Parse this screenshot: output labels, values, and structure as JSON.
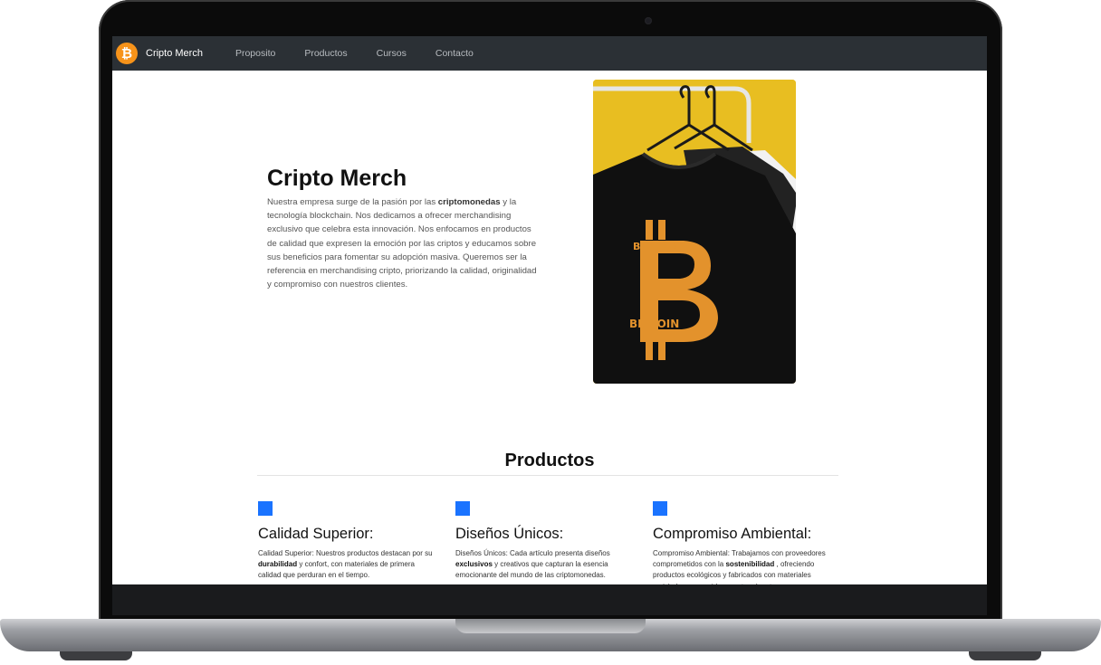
{
  "navbar": {
    "logo_symbol": "₿",
    "brand": "Cripto Merch",
    "links": [
      "Proposito",
      "Productos",
      "Cursos",
      "Contacto"
    ]
  },
  "hero": {
    "title": "Cripto Merch",
    "text_before": "Nuestra empresa surge de la pasión por las ",
    "text_bold": "criptomonedas",
    "text_after": " y la tecnología blockchain. Nos dedicamos a ofrecer merchandising exclusivo que celebra esta innovación. Nos enfocamos en productos de calidad que expresen la emoción por las criptos y educamos sobre sus beneficios para fomentar su adopción masiva. Queremos ser la referencia en merchandising cripto, priorizando la calidad, originalidad y compromiso con nuestros clientes.",
    "image_word": "BITCOIN"
  },
  "products": {
    "title": "Productos",
    "items": [
      {
        "title": "Calidad Superior:",
        "pre": "Calidad Superior: Nuestros productos destacan por su ",
        "bold": "durabilidad",
        "post": " y confort, con materiales de primera calidad que perduran en el tiempo."
      },
      {
        "title": "Diseños Únicos:",
        "pre": "Diseños Únicos: Cada artículo presenta diseños ",
        "bold": "exclusivos",
        "post": " y creativos que capturan la esencia emocionante del mundo de las criptomonedas."
      },
      {
        "title": "Compromiso Ambiental:",
        "pre": "Compromiso Ambiental: Trabajamos con proveedores comprometidos con la ",
        "bold": "sostenibilidad",
        "post": " , ofreciendo productos ecológicos y fabricados con materiales reciclados para cuidar nuestro planeta."
      }
    ]
  },
  "colors": {
    "navbar": "#2b3035",
    "bitcoin_orange": "#f7931a",
    "accent_blue": "#1a73ff",
    "image_background": "#e8be21"
  }
}
